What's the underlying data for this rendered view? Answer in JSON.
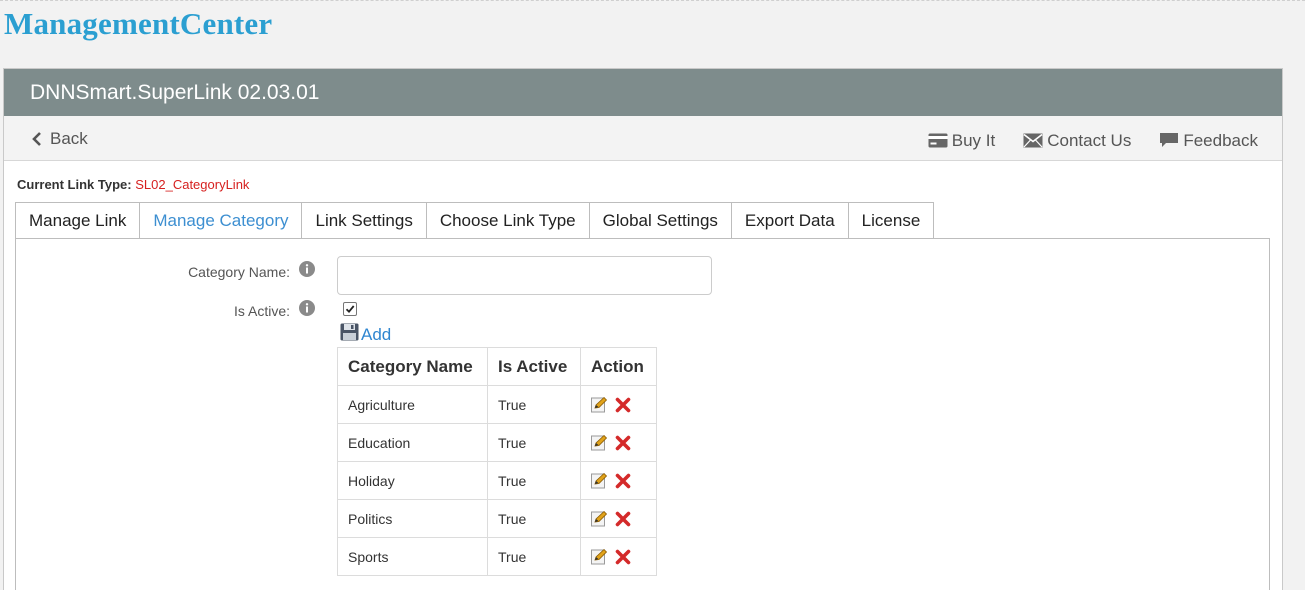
{
  "site": {
    "title": "ManagementCenter"
  },
  "module": {
    "title": "DNNSmart.SuperLink 02.03.01"
  },
  "toolbar": {
    "back_label": "Back",
    "buy_label": "Buy It",
    "contact_label": "Contact Us",
    "feedback_label": "Feedback"
  },
  "link_type": {
    "label": "Current Link Type:",
    "value": "SL02_CategoryLink"
  },
  "tabs": [
    {
      "label": "Manage Link"
    },
    {
      "label": "Manage Category"
    },
    {
      "label": "Link Settings"
    },
    {
      "label": "Choose Link Type"
    },
    {
      "label": "Global Settings"
    },
    {
      "label": "Export Data"
    },
    {
      "label": "License"
    }
  ],
  "active_tab": "Manage Category",
  "form": {
    "category_name_label": "Category Name:",
    "category_name_value": "",
    "is_active_label": "Is Active:",
    "is_active_checked": true,
    "add_label": "Add"
  },
  "table": {
    "headers": {
      "name": "Category Name",
      "active": "Is Active",
      "action": "Action"
    },
    "rows": [
      {
        "name": "Agriculture",
        "active": "True"
      },
      {
        "name": "Education",
        "active": "True"
      },
      {
        "name": "Holiday",
        "active": "True"
      },
      {
        "name": "Politics",
        "active": "True"
      },
      {
        "name": "Sports",
        "active": "True"
      }
    ]
  },
  "colors": {
    "title": "#2b9fd1",
    "header_bar": "#7e8c8c",
    "active_tab": "#3d8fd1",
    "link_type_value": "#d6201f",
    "delete_icon": "#d42a2a",
    "add_link": "#2f86d0"
  }
}
